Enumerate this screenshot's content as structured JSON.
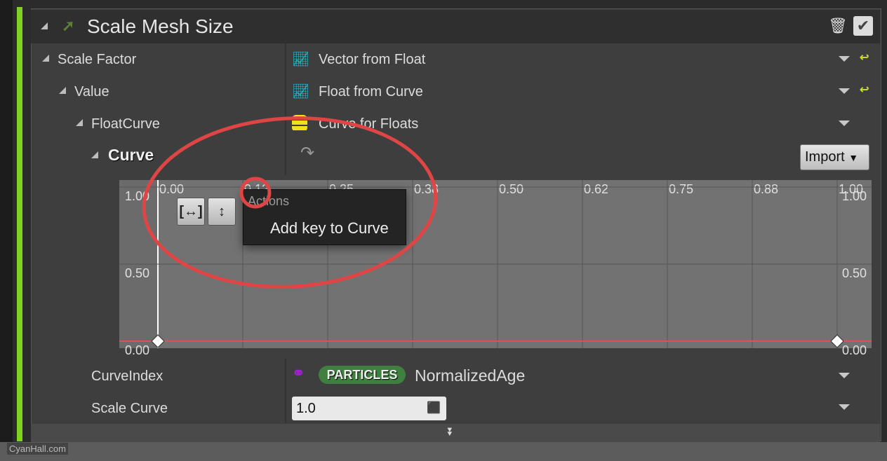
{
  "header": {
    "title": "Scale Mesh Size",
    "icons": [
      "arrow-icon",
      "trash-icon",
      "checkbox-checked-icon"
    ]
  },
  "rows": [
    {
      "label": "Scale Factor",
      "value": "Vector from Float",
      "icon": "chart-icon",
      "reset": true
    },
    {
      "label": "Value",
      "value": "Float from Curve",
      "icon": "chart-icon",
      "reset": true
    },
    {
      "label": "FloatCurve",
      "value": "Curve for Floats",
      "icon": "database-icon",
      "reset": false
    }
  ],
  "curve": {
    "label": "Curve",
    "import_label": "Import"
  },
  "graph": {
    "x_ticks": [
      "0.00",
      "0.12",
      "0.25",
      "0.38",
      "0.50",
      "0.62",
      "0.75",
      "0.88",
      "1.00"
    ],
    "y_ticks_left": [
      "1.00",
      "0.50",
      "0.00"
    ],
    "y_ticks_right": [
      "1.00",
      "0.50",
      "0.00"
    ],
    "curve_color": "#e05050",
    "keys": [
      {
        "time": 0.0,
        "value": 0.0
      },
      {
        "time": 1.0,
        "value": 0.0
      }
    ]
  },
  "popup": {
    "section": "Actions",
    "item": "Add key to Curve"
  },
  "curve_index": {
    "label": "CurveIndex",
    "badge": "PARTICLES",
    "value": "NormalizedAge",
    "badge_color": "#3f7f3f"
  },
  "scale_curve": {
    "label": "Scale Curve",
    "value": "1.0"
  },
  "watermark": "CyanHall.com",
  "annotation_color": "#e04545"
}
